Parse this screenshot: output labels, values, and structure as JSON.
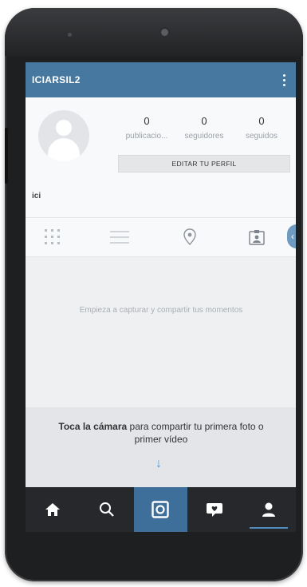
{
  "appbar": {
    "title": "ICIARSIL2",
    "menu_icon": "kebab-menu-icon"
  },
  "profile": {
    "username": "ici",
    "stats": [
      {
        "value": "0",
        "label": "publicacio..."
      },
      {
        "value": "0",
        "label": "seguidores"
      },
      {
        "value": "0",
        "label": "seguidos"
      }
    ],
    "edit_button": "EDITAR TU PERFIL"
  },
  "tabs": [
    {
      "icon": "grid-icon"
    },
    {
      "icon": "list-icon"
    },
    {
      "icon": "location-pin-icon"
    },
    {
      "icon": "tagged-photo-icon"
    }
  ],
  "empty_state": {
    "message": "Empieza a capturar y compartir tus momentos"
  },
  "cta": {
    "bold": "Toca la cámara",
    "rest": " para compartir tu primera foto o primer vídeo",
    "arrow": "↓"
  },
  "bottom_nav": [
    {
      "icon": "home-icon"
    },
    {
      "icon": "search-icon"
    },
    {
      "icon": "camera-icon",
      "highlighted": true
    },
    {
      "icon": "activity-icon"
    },
    {
      "icon": "profile-icon",
      "active": true
    }
  ],
  "colors": {
    "accent": "#4778a0",
    "nav_bg": "#26282b",
    "camera_tab": "#3d6f9a"
  }
}
